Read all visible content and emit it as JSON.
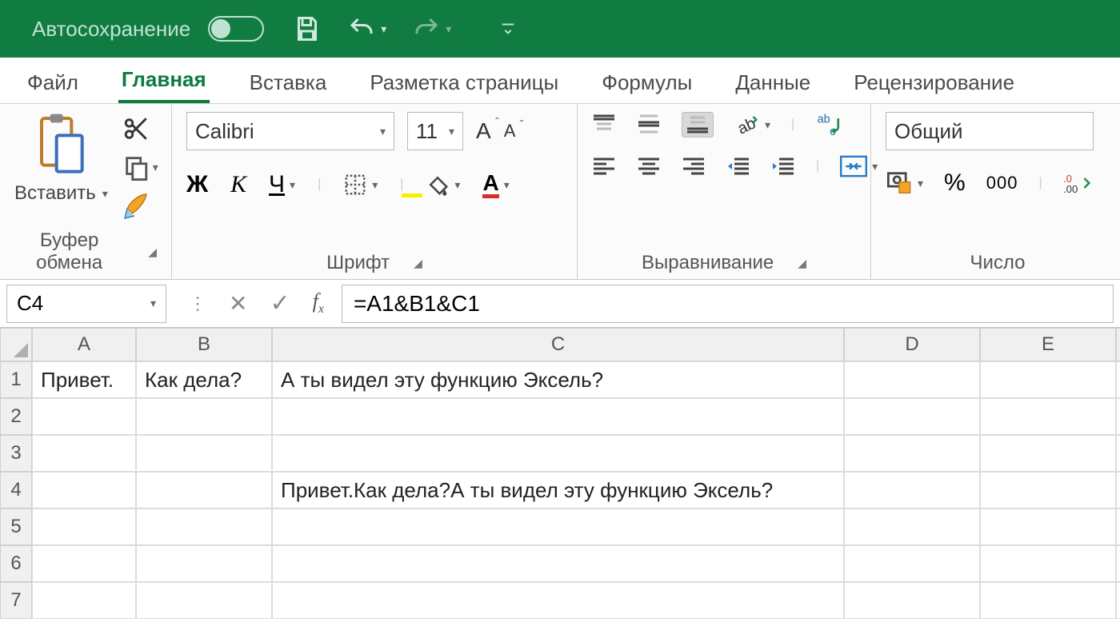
{
  "titlebar": {
    "autosave_label": "Автосохранение",
    "autosave_on": false
  },
  "tabs": {
    "items": [
      "Файл",
      "Главная",
      "Вставка",
      "Разметка страницы",
      "Формулы",
      "Данные",
      "Рецензирование"
    ],
    "active_index": 1
  },
  "ribbon": {
    "clipboard": {
      "paste_label": "Вставить",
      "group_label": "Буфер обмена"
    },
    "font": {
      "font_name": "Calibri",
      "font_size": "11",
      "increase_A": "A",
      "decrease_A": "A",
      "bold": "Ж",
      "italic": "К",
      "underline": "Ч",
      "group_label": "Шрифт"
    },
    "alignment": {
      "wrap_text": "ab",
      "group_label": "Выравнивание"
    },
    "number": {
      "format_name": "Общий",
      "percent": "%",
      "thousands": "000",
      "group_label": "Число"
    }
  },
  "name_box": "C4",
  "formula_bar": "=A1&B1&C1",
  "columns": [
    "A",
    "B",
    "C",
    "D",
    "E",
    ""
  ],
  "rows": [
    {
      "num": "1",
      "cells": [
        "Привет.",
        "Как дела?",
        "А ты видел эту функцию Эксель?",
        "",
        "",
        ""
      ]
    },
    {
      "num": "2",
      "cells": [
        "",
        "",
        "",
        "",
        "",
        ""
      ]
    },
    {
      "num": "3",
      "cells": [
        "",
        "",
        "",
        "",
        "",
        ""
      ]
    },
    {
      "num": "4",
      "cells": [
        "",
        "",
        "Привет.Как дела?А ты видел эту функцию Эксель?",
        "",
        "",
        ""
      ]
    },
    {
      "num": "5",
      "cells": [
        "",
        "",
        "",
        "",
        "",
        ""
      ]
    },
    {
      "num": "6",
      "cells": [
        "",
        "",
        "",
        "",
        "",
        ""
      ]
    },
    {
      "num": "7",
      "cells": [
        "",
        "",
        "",
        "",
        "",
        ""
      ]
    }
  ]
}
